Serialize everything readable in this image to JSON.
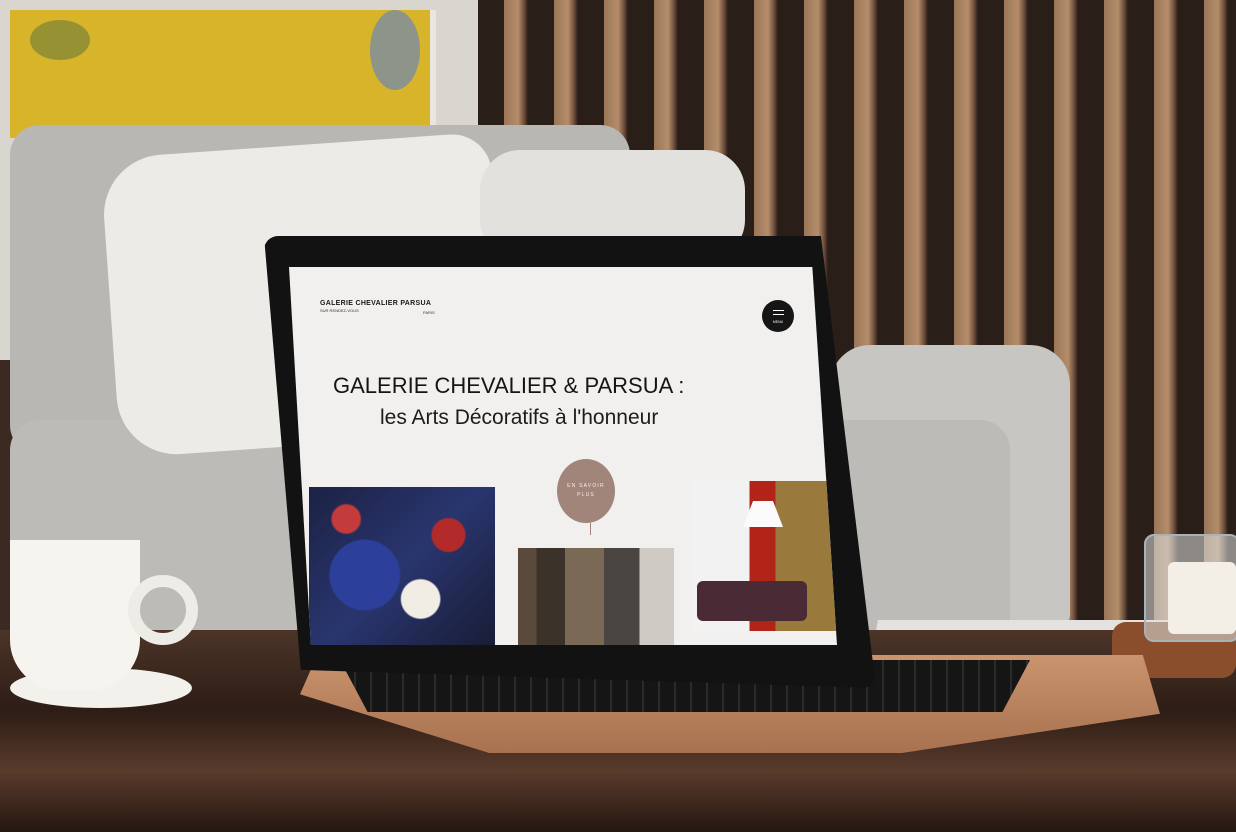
{
  "scene": {
    "accent_colors": {
      "cta_circle": "#a1857a",
      "menu_button": "#151515",
      "screen_bg": "#f1f0ee"
    }
  },
  "website": {
    "logo": "GALERIE CHEVALIER PARSUA",
    "logo_sub": "SUR RENDEZ-VOUS",
    "logo_city": "PARIS",
    "menu_label": "MENU",
    "hero_line1": "GALERIE CHEVALIER & PARSUA :",
    "hero_line2": "les Arts Décoratifs à l'honneur",
    "cta_line1": "EN SAVOIR",
    "cta_line2": "PLUS"
  }
}
